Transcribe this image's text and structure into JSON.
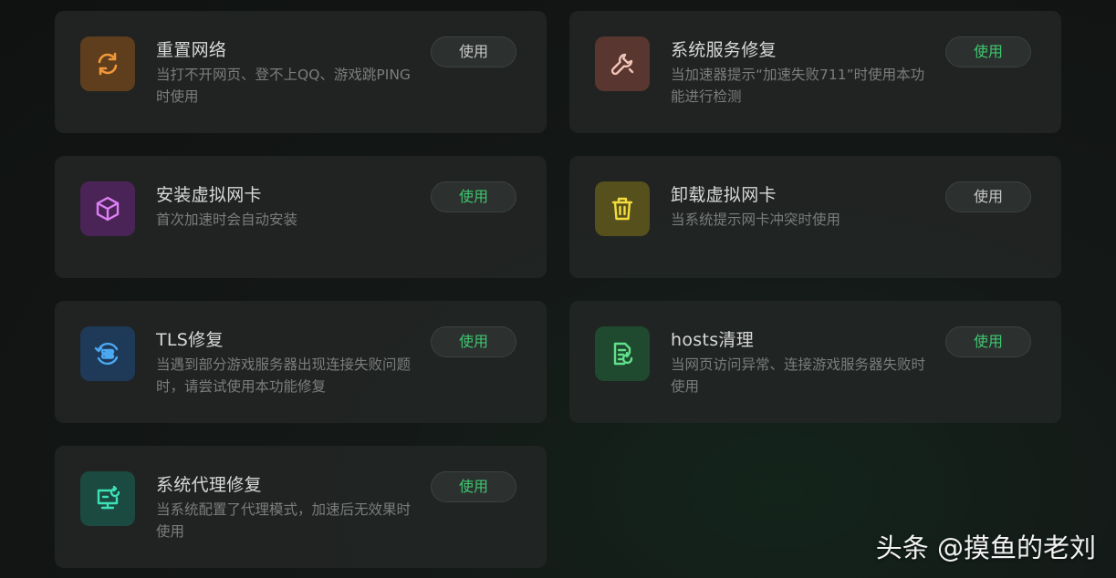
{
  "tools": [
    {
      "title": "重置网络",
      "desc": "当打不开网页、登不上QQ、游戏跳PING时使用",
      "button": "使用",
      "button_color": "#c8c8c8",
      "icon": "refresh-icon",
      "icon_bg": "#5e3e1c",
      "icon_color": "#f0973a"
    },
    {
      "title": "系统服务修复",
      "desc": "当加速器提示“加速失败711”时使用本功能进行检测",
      "button": "使用",
      "button_color": "#3fc76f",
      "icon": "wrench-icon",
      "icon_bg": "#5a3630",
      "icon_color": "#f2c4b8"
    },
    {
      "title": "安装虚拟网卡",
      "desc": "首次加速时会自动安装",
      "button": "使用",
      "button_color": "#3fc76f",
      "icon": "cube-icon",
      "icon_bg": "#4b2457",
      "icon_color": "#dd7ef5"
    },
    {
      "title": "卸载虚拟网卡",
      "desc": "当系统提示网卡冲突时使用",
      "button": "使用",
      "button_color": "#c8c8c8",
      "icon": "trash-icon",
      "icon_bg": "#56501c",
      "icon_color": "#f3dc3f"
    },
    {
      "title": "TLS修复",
      "desc": "当遇到部分游戏服务器出现连接失败问题时，请尝试使用本功能修复",
      "button": "使用",
      "button_color": "#3fc76f",
      "icon": "tls-repair-icon",
      "icon_bg": "#1e3a58",
      "icon_color": "#4ba8f2"
    },
    {
      "title": "hosts清理",
      "desc": "当网页访问异常、连接游戏服务器失败时使用",
      "button": "使用",
      "button_color": "#3fc76f",
      "icon": "file-clean-icon",
      "icon_bg": "#1f4a2f",
      "icon_color": "#5fe08a"
    },
    {
      "title": "系统代理修复",
      "desc": "当系统配置了代理模式，加速后无效果时使用",
      "button": "使用",
      "button_color": "#3fc76f",
      "icon": "monitor-proxy-icon",
      "icon_bg": "#1a4a40",
      "icon_color": "#3ee0b8"
    }
  ],
  "watermark": "头条 @摸鱼的老刘"
}
